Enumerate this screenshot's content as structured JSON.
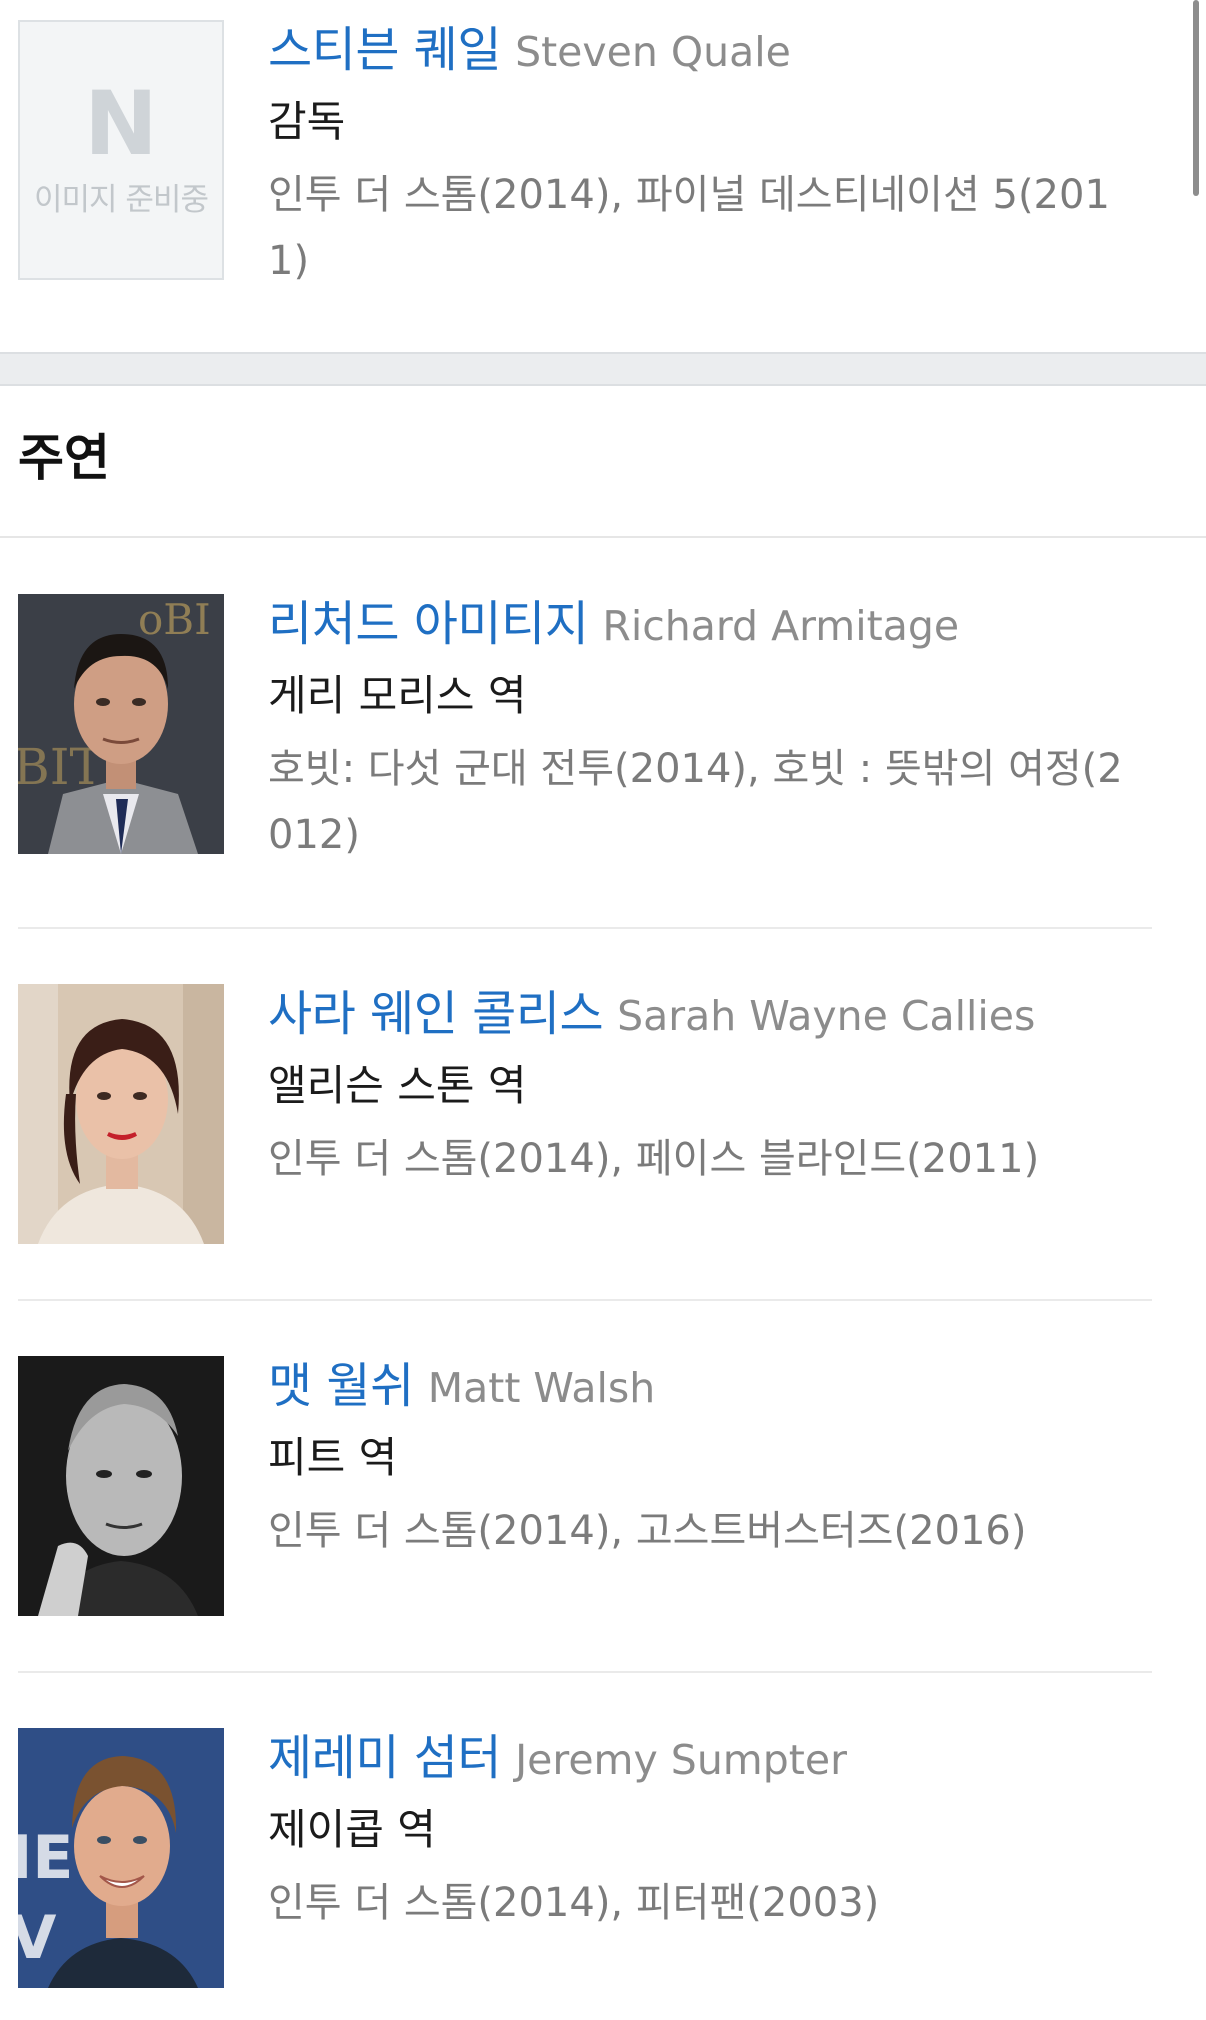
{
  "director": {
    "placeholder_logo": "N",
    "placeholder_text": "이미지 준비중",
    "name_ko": "스티븐 퀘일",
    "name_en": "Steven Quale",
    "role": "감독",
    "works": "인투 더 스톰(2014), 파이널 데스티네이션 5(2011)"
  },
  "cast_section": {
    "title": "주연"
  },
  "cast": [
    {
      "name_ko": "리처드 아미티지",
      "name_en": "Richard Armitage",
      "role": "게리 모리스 역",
      "works": "호빗: 다섯 군대 전투(2014), 호빗 : 뜻밖의 여정(2012)"
    },
    {
      "name_ko": "사라 웨인 콜리스",
      "name_en": "Sarah Wayne Callies",
      "role": "앨리슨 스톤 역",
      "works": "인투 더 스톰(2014), 페이스 블라인드(2011)"
    },
    {
      "name_ko": "맷 월쉬",
      "name_en": "Matt Walsh",
      "role": "피트 역",
      "works": "인투 더 스톰(2014), 고스트버스터즈(2016)"
    },
    {
      "name_ko": "제레미 섬터",
      "name_en": "Jeremy Sumpter",
      "role": "제이콥 역",
      "works": "인투 더 스톰(2014), 피터팬(2003)"
    }
  ],
  "colors": {
    "link_blue": "#1f6fc3",
    "muted_gray": "#8c8c8c",
    "section_gap": "#ebedef"
  }
}
